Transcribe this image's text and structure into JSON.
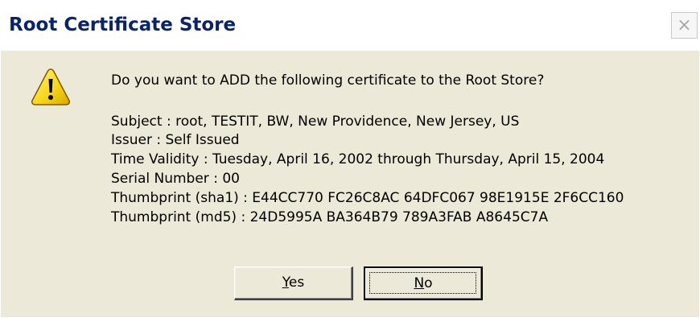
{
  "window": {
    "title": "Root Certificate Store",
    "close_glyph": "×"
  },
  "message": {
    "question": "Do you want to ADD the following certificate to the Root Store?",
    "subject": "Subject : root, TESTIT, BW, New Providence, New Jersey, US",
    "issuer": "Issuer : Self Issued",
    "time_validity": "Time Validity : Tuesday, April 16, 2002 through Thursday, April 15, 2004",
    "serial_number": "Serial Number : 00",
    "thumbprint_sha1": "Thumbprint (sha1) : E44CC770 FC26C8AC 64DFC067 98E1915E 2F6CC160",
    "thumbprint_md5": "Thumbprint (md5) : 24D5995A BA364B79 789A3FAB A8645C7A"
  },
  "buttons": {
    "yes": {
      "mnemonic": "Y",
      "rest": "es"
    },
    "no": {
      "mnemonic": "N",
      "rest": "o"
    }
  },
  "icon": "warning-icon",
  "colors": {
    "title_text": "#0a246a",
    "dialog_bg": "#ece9d8",
    "warning_yellow": "#f8d81c"
  }
}
